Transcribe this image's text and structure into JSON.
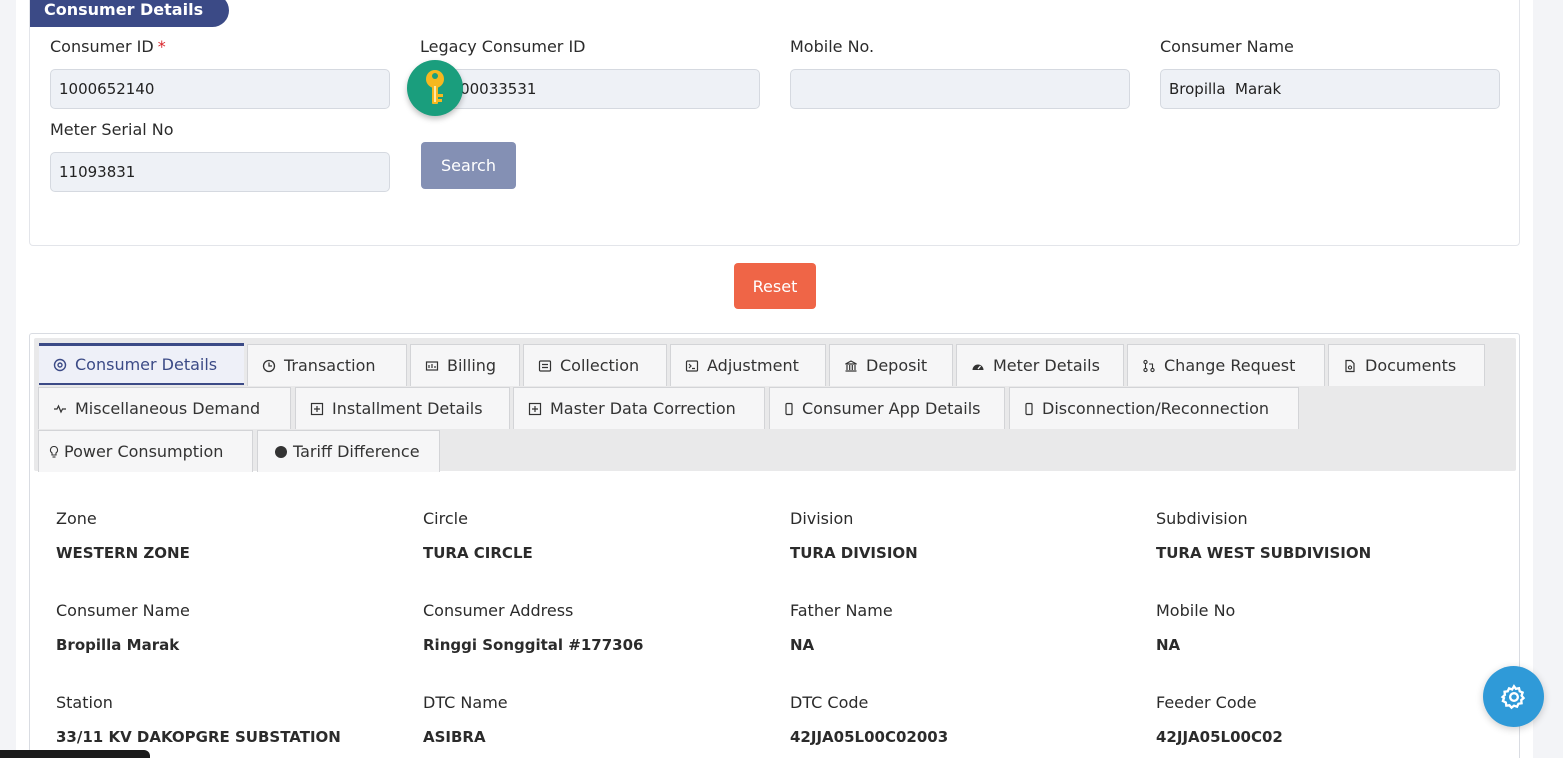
{
  "search_card": {
    "badge": "Consumer Details",
    "consumer_id_label": "Consumer ID",
    "required_mark": "*",
    "consumer_id_value": "1000652140",
    "legacy_id_label": "Legacy Consumer ID",
    "legacy_id_value": "1000033531",
    "mobile_label": "Mobile No.",
    "mobile_value": "",
    "consumer_name_label": "Consumer Name",
    "consumer_name_value": "Bropilla  Marak",
    "meter_serial_label": "Meter Serial No",
    "meter_serial_value": "11093831",
    "search_button": "Search"
  },
  "reset_button": "Reset",
  "tabs": [
    {
      "label": "Consumer Details",
      "icon": "target-icon"
    },
    {
      "label": "Transaction",
      "icon": "clock-icon"
    },
    {
      "label": "Billing",
      "icon": "billing-icon"
    },
    {
      "label": "Collection",
      "icon": "collection-icon"
    },
    {
      "label": "Adjustment",
      "icon": "terminal-icon"
    },
    {
      "label": "Deposit",
      "icon": "bank-icon"
    },
    {
      "label": "Meter Details",
      "icon": "speedometer-icon"
    },
    {
      "label": "Change Request",
      "icon": "git-pull-icon"
    },
    {
      "label": "Documents",
      "icon": "document-icon"
    },
    {
      "label": "Miscellaneous Demand",
      "icon": "pulse-icon"
    },
    {
      "label": "Installment Details",
      "icon": "plus-square-icon"
    },
    {
      "label": "Master Data Correction",
      "icon": "plus-square-icon"
    },
    {
      "label": "Consumer App Details",
      "icon": "phone-icon"
    },
    {
      "label": "Disconnection/Reconnection",
      "icon": "phone-icon"
    },
    {
      "label": "Power Consumption",
      "icon": "bulb-icon"
    },
    {
      "label": "Tariff Difference",
      "icon": "dot-icon"
    }
  ],
  "details": {
    "zone_label": "Zone",
    "zone": "WESTERN ZONE",
    "circle_label": "Circle",
    "circle": "TURA CIRCLE",
    "division_label": "Division",
    "division": "TURA DIVISION",
    "subdivision_label": "Subdivision",
    "subdivision": "TURA WEST SUBDIVISION",
    "consumer_name_label": "Consumer Name",
    "consumer_name": "Bropilla Marak",
    "consumer_address_label": "Consumer Address",
    "consumer_address": "Ringgi Songgital #177306",
    "father_name_label": "Father Name",
    "father_name": "NA",
    "mobile_label": "Mobile No",
    "mobile": "NA",
    "station_label": "Station",
    "station": "33/11 KV DAKOPGRE SUBSTATION",
    "dtc_name_label": "DTC Name",
    "dtc_name": "ASIBRA",
    "dtc_code_label": "DTC Code",
    "dtc_code": "42JJA05L00C02003",
    "feeder_code_label": "Feeder Code",
    "feeder_code": "42JJA05L00C02"
  },
  "colors": {
    "primary": "#3b4a86",
    "search_button": "#8490b4",
    "reset_button": "#ef6547",
    "fab": "#2f9ad8",
    "key_badge": "#1a9e7d"
  }
}
